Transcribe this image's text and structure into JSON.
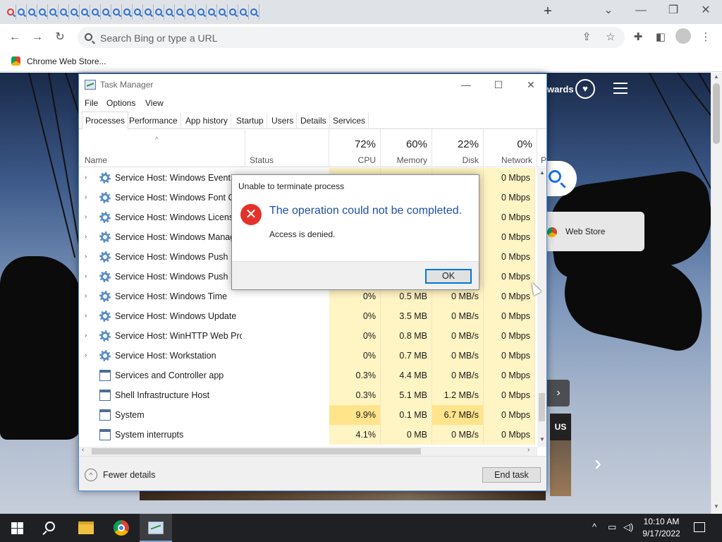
{
  "browser": {
    "tab_count": 24,
    "new_tab_label": "+",
    "omnibox_placeholder": "Search Bing or type a URL",
    "bookmark_label": "Chrome Web Store..."
  },
  "bing_page": {
    "rewards_label": "wards",
    "web_store_label": "Web Store",
    "region_label": "US"
  },
  "task_manager": {
    "title": "Task Manager",
    "menu": [
      "File",
      "Options",
      "View"
    ],
    "tabs": [
      "Processes",
      "Performance",
      "App history",
      "Startup",
      "Users",
      "Details",
      "Services"
    ],
    "active_tab": "Processes",
    "columns": {
      "name": "Name",
      "status": "Status",
      "cpu": {
        "pct": "72%",
        "label": "CPU"
      },
      "memory": {
        "pct": "60%",
        "label": "Memory"
      },
      "disk": {
        "pct": "22%",
        "label": "Disk"
      },
      "network": {
        "pct": "0%",
        "label": "Network"
      },
      "power_partial": "P"
    },
    "rows": [
      {
        "name": "Service Host: Windows Event Log",
        "group": true,
        "cpu": "",
        "mem": "",
        "disk": "",
        "net": "0 Mbps"
      },
      {
        "name": "Service Host: Windows Font Cache Service",
        "group": true,
        "cpu": "",
        "mem": "",
        "disk": "",
        "net": "0 Mbps"
      },
      {
        "name": "Service Host: Windows License Manager Service",
        "group": true,
        "cpu": "",
        "mem": "",
        "disk": "",
        "net": "0 Mbps"
      },
      {
        "name": "Service Host: Windows Management Instrumentation",
        "group": true,
        "cpu": "",
        "mem": "",
        "disk": "",
        "net": "0 Mbps"
      },
      {
        "name": "Service Host: Windows Push Notifications",
        "group": true,
        "cpu": "",
        "mem": "",
        "disk": "",
        "net": "0 Mbps"
      },
      {
        "name": "Service Host: Windows Push Notifications",
        "group": true,
        "cpu": "",
        "mem": "",
        "disk": "",
        "net": "0 Mbps"
      },
      {
        "name": "Service Host: Windows Time",
        "group": true,
        "cpu": "0%",
        "mem": "0.5 MB",
        "disk": "0 MB/s",
        "net": "0 Mbps"
      },
      {
        "name": "Service Host: Windows Update",
        "group": true,
        "cpu": "0%",
        "mem": "3.5 MB",
        "disk": "0 MB/s",
        "net": "0 Mbps"
      },
      {
        "name": "Service Host: WinHTTP Web Pro...",
        "group": true,
        "cpu": "0%",
        "mem": "0.8 MB",
        "disk": "0 MB/s",
        "net": "0 Mbps"
      },
      {
        "name": "Service Host: Workstation",
        "group": true,
        "cpu": "0%",
        "mem": "0.7 MB",
        "disk": "0 MB/s",
        "net": "0 Mbps"
      },
      {
        "name": "Services and Controller app",
        "group": false,
        "cpu": "0.3%",
        "mem": "4.4 MB",
        "disk": "0 MB/s",
        "net": "0 Mbps"
      },
      {
        "name": "Shell Infrastructure Host",
        "group": false,
        "cpu": "0.3%",
        "mem": "5.1 MB",
        "disk": "1.2 MB/s",
        "net": "0 Mbps"
      },
      {
        "name": "System",
        "group": false,
        "cpu": "9.9%",
        "mem": "0.1 MB",
        "disk": "6.7 MB/s",
        "net": "0 Mbps"
      },
      {
        "name": "System interrupts",
        "group": false,
        "cpu": "4.1%",
        "mem": "0 MB",
        "disk": "0 MB/s",
        "net": "0 Mbps"
      }
    ],
    "fewer_details_label": "Fewer details",
    "end_task_label": "End task"
  },
  "dialog": {
    "title": "Unable to terminate process",
    "main_instruction": "The operation could not be completed.",
    "content": "Access is denied.",
    "ok_label": "OK"
  },
  "taskbar": {
    "time": "10:10 AM",
    "date": "9/17/2022"
  },
  "colors": {
    "cpu_heat_low": "#fff4c4",
    "cpu_heat_high": "#ffe48c",
    "dialog_accent": "#1e4fa5",
    "error_red": "#e4322b",
    "selection_blue": "#0078d7"
  }
}
